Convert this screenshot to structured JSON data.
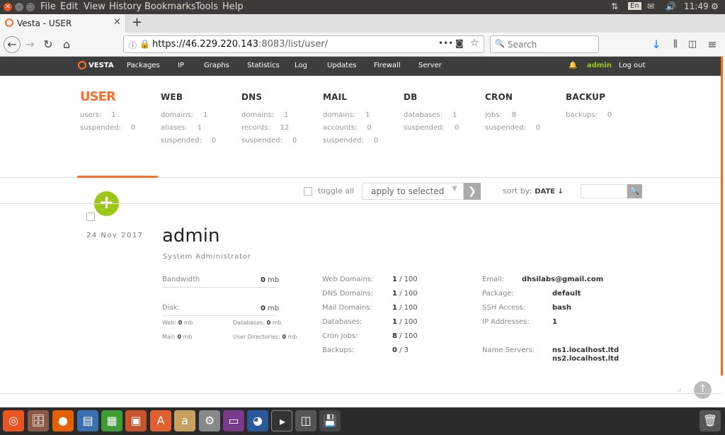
{
  "system_menu": [
    "File",
    "Edit",
    "View",
    "History",
    "Bookmarks",
    "Tools",
    "Help"
  ],
  "system_indicators": {
    "keyboard": "En",
    "time": "11:49"
  },
  "browser": {
    "tab_title": "Vesta - USER",
    "url_host": "https://46.229.220.143",
    "url_rest": ":8083/list/user/",
    "search_placeholder": "Search"
  },
  "vesta_nav": {
    "logo": "VESTA",
    "items": [
      "Packages",
      "IP",
      "Graphs",
      "Statistics",
      "Log",
      "Updates",
      "Firewall",
      "Server"
    ],
    "user": "admin",
    "logout": "Log out"
  },
  "categories": [
    {
      "title": "USER",
      "stats": [
        {
          "label": "users:",
          "value": "1"
        },
        {
          "label": "suspended:",
          "value": "0"
        }
      ]
    },
    {
      "title": "WEB",
      "stats": [
        {
          "label": "domains:",
          "value": "1"
        },
        {
          "label": "aliases:",
          "value": "1"
        },
        {
          "label": "suspended:",
          "value": "0"
        }
      ]
    },
    {
      "title": "DNS",
      "stats": [
        {
          "label": "domains:",
          "value": "1"
        },
        {
          "label": "records:",
          "value": "12"
        },
        {
          "label": "suspended:",
          "value": "0"
        }
      ]
    },
    {
      "title": "MAIL",
      "stats": [
        {
          "label": "domains:",
          "value": "1"
        },
        {
          "label": "accounts:",
          "value": "0"
        },
        {
          "label": "suspended:",
          "value": "0"
        }
      ]
    },
    {
      "title": "DB",
      "stats": [
        {
          "label": "databases:",
          "value": "1"
        },
        {
          "label": "suspended:",
          "value": "0"
        }
      ]
    },
    {
      "title": "CRON",
      "stats": [
        {
          "label": "jobs:",
          "value": "8"
        },
        {
          "label": "suspended:",
          "value": "0"
        }
      ]
    },
    {
      "title": "BACKUP",
      "stats": [
        {
          "label": "backups:",
          "value": "0"
        }
      ]
    }
  ],
  "toolbar": {
    "add_label": "+",
    "toggle_all": "toggle all",
    "apply_to_selected": "apply to selected",
    "sort_by": "sort by:",
    "sort_field": "DATE ↓"
  },
  "user_record": {
    "date": "24  Nov  2017",
    "name": "admin",
    "role": "System Administrator",
    "bandwidth_label": "Bandwidth",
    "bandwidth_value": "0",
    "bandwidth_unit": "mb",
    "disk_label": "Disk:",
    "disk_value": "0",
    "disk_unit": "mb",
    "web_label": "Web:",
    "web_value": "0",
    "web_unit": "mb",
    "db_label": "Databases:",
    "db_value": "0",
    "db_unit": "mb",
    "mail_label": "Mail:",
    "mail_value": "0",
    "mail_unit": "mb",
    "udir_label": "User Directories:",
    "udir_value": "0",
    "udir_unit": "mb",
    "limits": [
      {
        "label": "Web Domains:",
        "used": "1",
        "max": " / 100"
      },
      {
        "label": "DNS Domains:",
        "used": "1",
        "max": " / 100"
      },
      {
        "label": "Mail Domains:",
        "used": "1",
        "max": " / 100"
      },
      {
        "label": "Databases:",
        "used": "1",
        "max": " / 100"
      },
      {
        "label": "Cron Jobs:",
        "used": "8",
        "max": " / 100"
      },
      {
        "label": "Backups:",
        "used": "0",
        "max": " / 3"
      }
    ],
    "details": [
      {
        "label": "Email:",
        "value": "dhsilabs@gmail.com"
      },
      {
        "label": "Package:",
        "value": "default"
      },
      {
        "label": "SSH Access:",
        "value": "bash"
      },
      {
        "label": "IP Addresses:",
        "value": "1"
      }
    ],
    "ns_label": "Name Servers:",
    "ns1": "ns1.localhost.ltd",
    "ns2": "ns2.localhost.ltd"
  }
}
